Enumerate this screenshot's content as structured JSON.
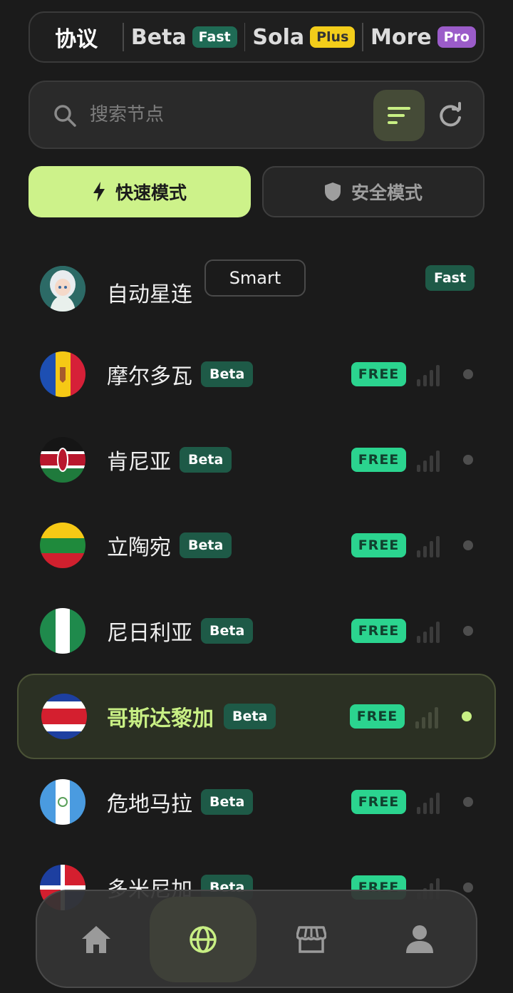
{
  "protocol_bar": {
    "title": "协议",
    "tabs": [
      {
        "name": "Beta",
        "badge": "Fast"
      },
      {
        "name": "Sola",
        "badge": "Plus"
      },
      {
        "name": "More",
        "badge": "Pro"
      }
    ]
  },
  "search": {
    "placeholder": "搜索节点",
    "value": ""
  },
  "modes": {
    "fast": {
      "label": "快速模式",
      "icon": "bolt-icon",
      "active": true
    },
    "safe": {
      "label": "安全模式",
      "icon": "shield-icon",
      "active": false
    }
  },
  "auto_node": {
    "name": "自动星连",
    "tag": "Smart",
    "badge": "Fast"
  },
  "nodes": [
    {
      "name": "摩尔多瓦",
      "badge": "Beta",
      "tier": "FREE",
      "selected": false
    },
    {
      "name": "肯尼亚",
      "badge": "Beta",
      "tier": "FREE",
      "selected": false
    },
    {
      "name": "立陶宛",
      "badge": "Beta",
      "tier": "FREE",
      "selected": false
    },
    {
      "name": "尼日利亚",
      "badge": "Beta",
      "tier": "FREE",
      "selected": false
    },
    {
      "name": "哥斯达黎加",
      "badge": "Beta",
      "tier": "FREE",
      "selected": true
    },
    {
      "name": "危地马拉",
      "badge": "Beta",
      "tier": "FREE",
      "selected": false
    },
    {
      "name": "多米尼加",
      "badge": "Beta",
      "tier": "FREE",
      "selected": false
    }
  ],
  "bottom_nav": [
    {
      "icon": "home-icon",
      "active": false
    },
    {
      "icon": "globe-icon",
      "active": true
    },
    {
      "icon": "store-icon",
      "active": false
    },
    {
      "icon": "user-icon",
      "active": false
    }
  ],
  "colors": {
    "background": "#1b1b1b",
    "accent": "#c8ef84",
    "free_badge": "#2bd48f",
    "beta_badge": "#1e5a47",
    "plus_badge": "#f3cd1a",
    "pro_badge": "#9b5cc9"
  }
}
